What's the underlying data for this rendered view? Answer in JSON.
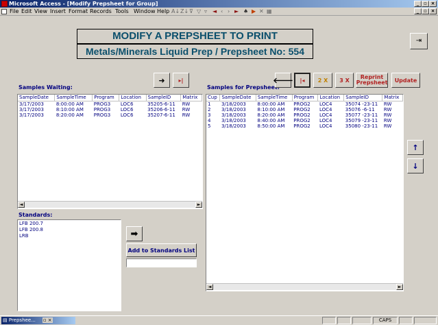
{
  "window": {
    "title": "Microsoft Access - [Modify Prepsheet for Group]"
  },
  "menu": [
    "File",
    "Edit",
    "View",
    "Insert",
    "Format",
    "Records",
    "Tools",
    "Window",
    "Help"
  ],
  "toolbar_icons": [
    "sort-ascending-icon",
    "sort-descending-icon",
    "filter-by-selection-icon",
    "filter-by-form-icon",
    "apply-filter-icon",
    "first-record-icon",
    "previous-record-icon",
    "next-record-icon",
    "last-record-icon",
    "find-icon",
    "new-record-icon",
    "delete-record-icon",
    "database-window-icon"
  ],
  "header": {
    "title": "MODIFY A PREPSHEET TO PRINT",
    "subtitle": "Metals/Minerals Liquid Prep / Prepsheet No: 554"
  },
  "waiting": {
    "label": "Samples Waiting:",
    "columns": [
      "SampleDate",
      "SampleTime",
      "Program",
      "Location",
      "SampleID",
      "Matrix"
    ],
    "rows": [
      [
        "3/17/2003",
        "8:00:00 AM",
        "PROG3",
        "LOC6",
        "35205-6-11",
        "RW"
      ],
      [
        "3/17/2003",
        "8:10:00 AM",
        "PROG3",
        "LOC6",
        "35206-6-11",
        "RW"
      ],
      [
        "3/17/2003",
        "8:20:00 AM",
        "PROG3",
        "LOC6",
        "35207-6-11",
        "RW"
      ]
    ]
  },
  "prepsheet": {
    "label": "Samples for Prepsheet:",
    "columns": [
      "Cup",
      "SampleDate",
      "SampleTime",
      "Program",
      "Location",
      "SampleID",
      "Matrix"
    ],
    "rows": [
      [
        "1",
        "3/18/2003",
        "8:00:00 AM",
        "PROG2",
        "LOC4",
        "35074 -23-11",
        "RW"
      ],
      [
        "2",
        "3/18/2003",
        "8:10:00 AM",
        "PROG2",
        "LOC4",
        "35076 -6-11",
        "RW"
      ],
      [
        "3",
        "3/18/2003",
        "8:20:00 AM",
        "PROG2",
        "LOC4",
        "35077 -23-11",
        "RW"
      ],
      [
        "4",
        "3/18/2003",
        "8:40:00 AM",
        "PROG2",
        "LOC4",
        "35079 -23-11",
        "RW"
      ],
      [
        "5",
        "3/18/2003",
        "8:50:00 AM",
        "PROG2",
        "LOC4",
        "35080 -23-11",
        "RW"
      ]
    ]
  },
  "buttons": {
    "two_x": "2 X",
    "three_x": "3 X",
    "reprint": "Reprint Prepsheet",
    "update": "Update",
    "add_standards": "Add to Standards List"
  },
  "standards": {
    "label": "Standards:",
    "items": [
      "LFB 200.7",
      "LFB 200.8",
      "LRB"
    ],
    "entry_value": ""
  },
  "statusbar": {
    "minimized_window": "Prepshee...",
    "caps": "CAPS"
  },
  "colors": {
    "header_text": "#0b4f6c",
    "label_text": "#00007f",
    "button_red": "#b22222",
    "title_bar": "#0a246a"
  }
}
